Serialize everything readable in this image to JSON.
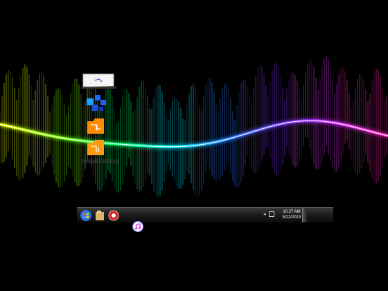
{
  "desktop": {
    "icons": [
      {
        "name": "note-icon"
      },
      {
        "name": "blocks-icon"
      },
      {
        "name": "folder-icon-1"
      },
      {
        "name": "folder-icon-2",
        "label": "Bellassomething"
      }
    ],
    "wallpaper": {
      "description": "",
      "colors": [
        "#ffff00",
        "#00ff66",
        "#00ccff",
        "#3366ff",
        "#cc33ff",
        "#ff33cc"
      ]
    }
  },
  "taskbar": {
    "clock_time": "10:27 AM",
    "clock_date": "5/22/2013"
  },
  "colors": {
    "accent": "#2f6cf0",
    "taskbar": "#1d1d1d"
  }
}
